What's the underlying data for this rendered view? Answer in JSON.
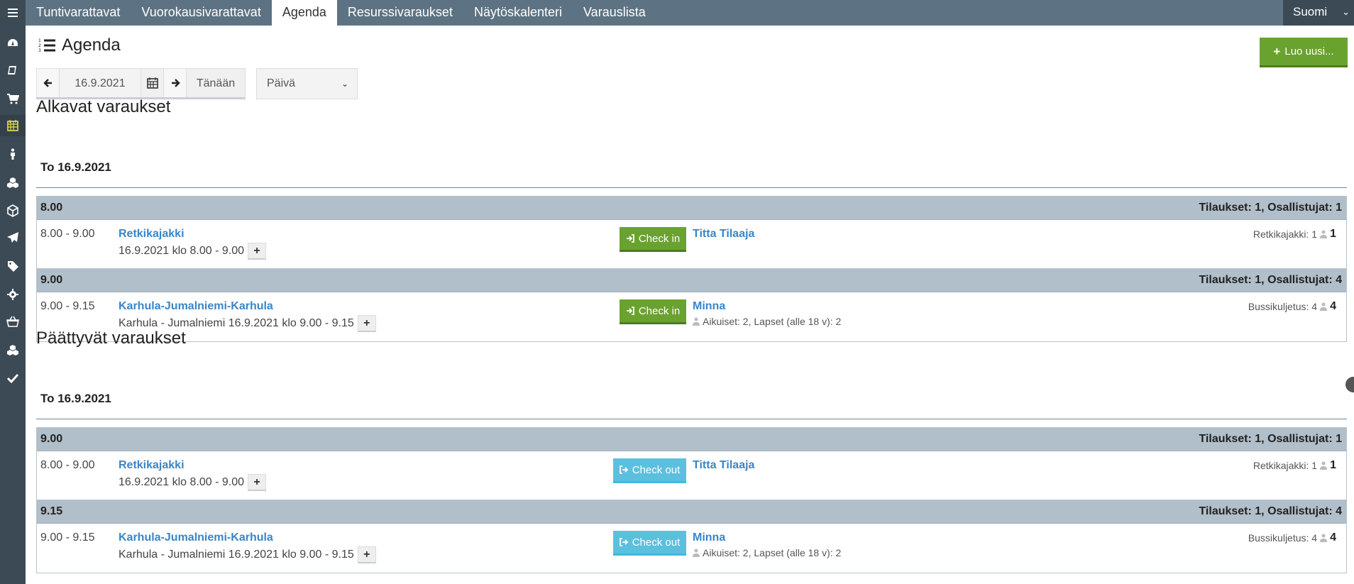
{
  "nav": {
    "tabs": [
      "Tuntivarattavat",
      "Vuorokausivarattavat",
      "Agenda",
      "Resurssivaraukset",
      "Näytöskalenteri",
      "Varauslista"
    ],
    "active_tab": "Agenda",
    "language": "Suomi"
  },
  "sidebar": {
    "icons": [
      "dashboard-icon",
      "book-icon",
      "cart-icon",
      "calendar-icon",
      "person-icon",
      "cubes-icon",
      "cube-icon",
      "send-icon",
      "tag-icon",
      "gear-icon",
      "basket-icon",
      "cubes-icon-2",
      "check-icon"
    ],
    "active_index": 3
  },
  "page": {
    "title": "Agenda",
    "new_button": "Luo uusi..."
  },
  "datebar": {
    "date": "16.9.2021",
    "today_label": "Tänään",
    "view_select": "Päivä"
  },
  "starting": {
    "title": "Alkavat varaukset",
    "day": "To 16.9.2021",
    "groups": [
      {
        "time": "8.00",
        "summary": "Tilaukset: 1, Osallistujat: 1",
        "row": {
          "time_range": "8.00 - 9.00",
          "name": "Retkikajakki",
          "sub": "16.9.2021 klo 8.00 - 9.00",
          "action": "Check in",
          "customer": "Titta Tilaaja",
          "people": "",
          "right_label": "Retkikajakki: 1",
          "right_count": "1"
        }
      },
      {
        "time": "9.00",
        "summary": "Tilaukset: 1, Osallistujat: 4",
        "row": {
          "time_range": "9.00 - 9.15",
          "name": "Karhula-Jumalniemi-Karhula",
          "sub": "Karhula - Jumalniemi 16.9.2021 klo 9.00 - 9.15",
          "action": "Check in",
          "customer": "Minna",
          "people": "Aikuiset: 2, Lapset (alle 18 v): 2",
          "right_label": "Bussikuljetus: 4",
          "right_count": "4"
        }
      }
    ]
  },
  "ending": {
    "title": "Päättyvät varaukset",
    "day": "To 16.9.2021",
    "groups": [
      {
        "time": "9.00",
        "summary": "Tilaukset: 1, Osallistujat: 1",
        "row": {
          "time_range": "8.00 - 9.00",
          "name": "Retkikajakki",
          "sub": "16.9.2021 klo 8.00 - 9.00",
          "action": "Check out",
          "customer": "Titta Tilaaja",
          "people": "",
          "right_label": "Retkikajakki: 1",
          "right_count": "1"
        }
      },
      {
        "time": "9.15",
        "summary": "Tilaukset: 1, Osallistujat: 4",
        "row": {
          "time_range": "9.00 - 9.15",
          "name": "Karhula-Jumalniemi-Karhula",
          "sub": "Karhula - Jumalniemi 16.9.2021 klo 9.00 - 9.15",
          "action": "Check out",
          "customer": "Minna",
          "people": "Aikuiset: 2, Lapset (alle 18 v): 2",
          "right_label": "Bussikuljetus: 4",
          "right_count": "4"
        }
      }
    ]
  },
  "colors": {
    "topbar": "#5d7383",
    "sidebar": "#3c4a55",
    "accent_green": "#6aa22f",
    "accent_cyan": "#5bc0de",
    "link_blue": "#3a85c7",
    "group_header": "#b0bfc9",
    "active_sidebar_icon": "#e6e14a"
  }
}
